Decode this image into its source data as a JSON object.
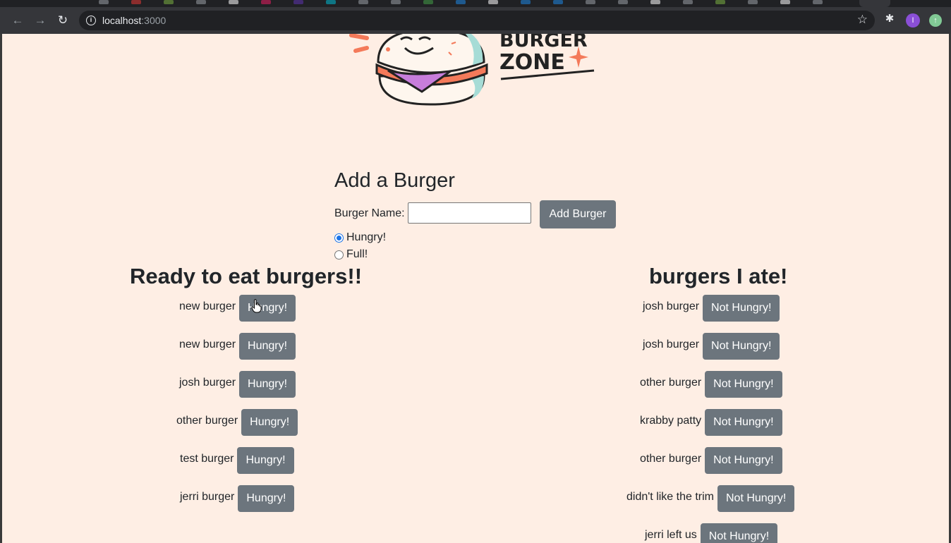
{
  "browser": {
    "url_host": "localhost",
    "url_port": ":3000",
    "profile_initial": "I"
  },
  "logo": {
    "line1": "BURGER",
    "line2": "ZONE"
  },
  "form": {
    "title": "Add a Burger",
    "name_label": "Burger Name:",
    "name_value": "",
    "submit_label": "Add Burger",
    "radio_hungry_label": "Hungry!",
    "radio_full_label": "Full!",
    "selected": "hungry"
  },
  "ready": {
    "heading": "Ready to eat burgers!!",
    "items": [
      {
        "name": "new burger",
        "button": "Hungry!"
      },
      {
        "name": "new burger",
        "button": "Hungry!"
      },
      {
        "name": "josh burger",
        "button": "Hungry!"
      },
      {
        "name": "other burger",
        "button": "Hungry!"
      },
      {
        "name": "test burger",
        "button": "Hungry!"
      },
      {
        "name": "jerri burger",
        "button": "Hungry!"
      }
    ]
  },
  "eaten": {
    "heading": "burgers I ate!",
    "items": [
      {
        "name": "josh burger",
        "button": "Not Hungry!"
      },
      {
        "name": "josh burger",
        "button": "Not Hungry!"
      },
      {
        "name": "other burger",
        "button": "Not Hungry!"
      },
      {
        "name": "krabby patty",
        "button": "Not Hungry!"
      },
      {
        "name": "other burger",
        "button": "Not Hungry!"
      },
      {
        "name": "didn't like the trim",
        "button": "Not Hungry!"
      },
      {
        "name": "jerri left us",
        "button": "Not Hungry!"
      }
    ]
  },
  "colors": {
    "page_bg": "#feeee4",
    "button_bg": "#6c757d",
    "logo_orange": "#f47a5a",
    "logo_purple": "#c77ddb",
    "logo_teal": "#a6dcd6"
  }
}
